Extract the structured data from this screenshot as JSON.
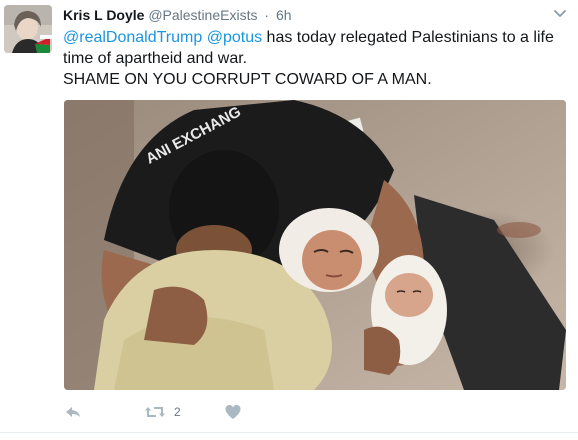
{
  "tweet": {
    "display_name": "Kris L Doyle",
    "handle": "@PalestineExists",
    "separator": "·",
    "time": "6h",
    "mention_1": "@realDonaldTrump",
    "mention_2": "@potus",
    "text_line_1": " has today relegated Palestinians to a life time of apartheid and war.",
    "text_line_2": "SHAME ON YOU CORRUPT COWARD OF A MAN.",
    "shirt_text": "ANI EXCHANG"
  },
  "actions": {
    "reply_icon": "reply-icon",
    "retweet_icon": "retweet-icon",
    "retweet_count": "2",
    "like_icon": "heart-icon"
  },
  "colors": {
    "link": "#1b95e0",
    "muted": "#657786",
    "text": "#14171a"
  }
}
